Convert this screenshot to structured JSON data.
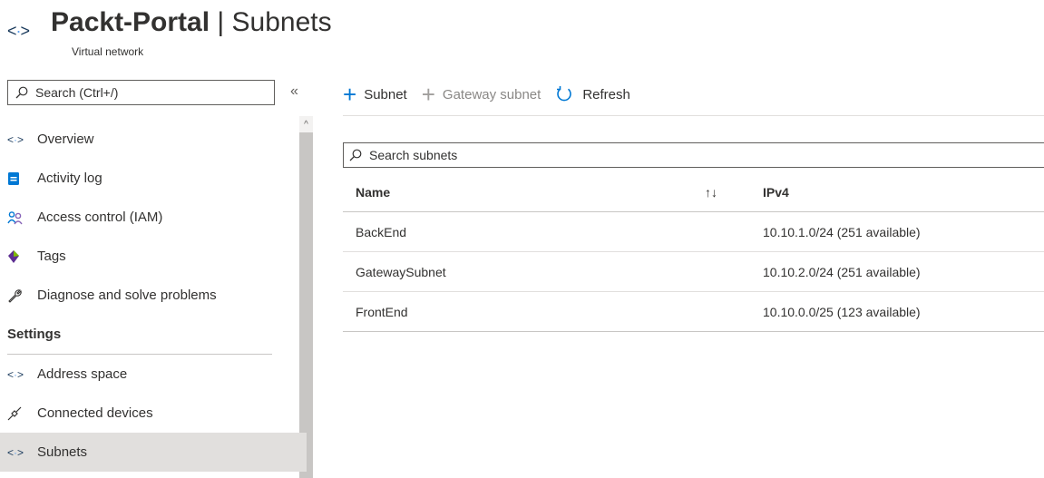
{
  "header": {
    "resource_name": "Packt-Portal",
    "separator": " | ",
    "page_name": "Subnets",
    "subtitle": "Virtual network"
  },
  "sidebar": {
    "search_placeholder": "Search (Ctrl+/)",
    "collapse_glyph": "«",
    "items": [
      {
        "label": "Overview",
        "icon": "vnet-icon"
      },
      {
        "label": "Activity log",
        "icon": "activity-log-icon"
      },
      {
        "label": "Access control (IAM)",
        "icon": "people-icon"
      },
      {
        "label": "Tags",
        "icon": "tag-icon"
      },
      {
        "label": "Diagnose and solve problems",
        "icon": "wrench-icon"
      }
    ],
    "settings_header": "Settings",
    "settings_items": [
      {
        "label": "Address space",
        "icon": "vnet-icon"
      },
      {
        "label": "Connected devices",
        "icon": "plug-icon"
      },
      {
        "label": "Subnets",
        "icon": "vnet-icon",
        "active": true
      }
    ]
  },
  "toolbar": {
    "add_subnet": "Subnet",
    "add_gateway_subnet": "Gateway subnet",
    "refresh": "Refresh"
  },
  "subnets": {
    "search_placeholder": "Search subnets",
    "columns": [
      "Name",
      "IPv4"
    ],
    "sort_glyph": "↑↓",
    "rows": [
      {
        "name": "BackEnd",
        "ipv4": "10.10.1.0/24 (251 available)"
      },
      {
        "name": "GatewaySubnet",
        "ipv4": "10.10.2.0/24 (251 available)"
      },
      {
        "name": "FrontEnd",
        "ipv4": "10.10.0.0/25 (123 available)"
      }
    ]
  },
  "colors": {
    "accent": "#0078d4",
    "active_bg": "#e1dfdd",
    "scrollbar": "#c8c6c4"
  }
}
